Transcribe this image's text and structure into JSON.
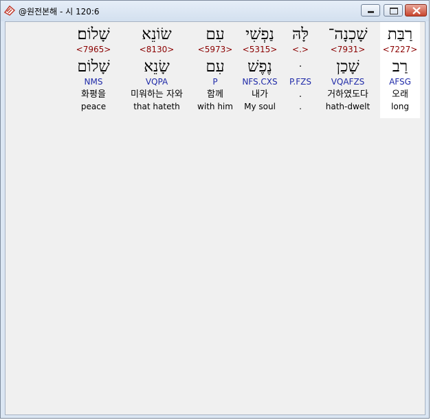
{
  "window": {
    "title": "@원전본해 - 시 120:6",
    "icon": "bible-app-icon"
  },
  "words": [
    {
      "hebrew": "רַבַּת",
      "strong": "<7227>",
      "lemma": "רַב",
      "morph": "AFSG",
      "korean": "오래",
      "english": "long",
      "highlight": true
    },
    {
      "hebrew": "שָׁכְנָה־",
      "strong": "<7931>",
      "lemma": "שָׁכַן",
      "morph": "VQAFZS",
      "korean": "거하였도다",
      "english": "hath-dwelt",
      "highlight": false
    },
    {
      "hebrew": "לָּהּ",
      "strong": "<.>",
      "lemma": "ּ",
      "morph": "P.FZS",
      "korean": ".",
      "english": ".",
      "highlight": false
    },
    {
      "hebrew": "נַפְשִׁי",
      "strong": "<5315>",
      "lemma": "נֶפֶשׁ",
      "morph": "NFS.CXS",
      "korean": "내가",
      "english": "My soul",
      "highlight": false
    },
    {
      "hebrew": "עִם",
      "strong": "<5973>",
      "lemma": "עִם",
      "morph": "P",
      "korean": "함께",
      "english": "with him",
      "highlight": false
    },
    {
      "hebrew": "שׂוֹנֵא",
      "strong": "<8130>",
      "lemma": "שָׂנֵא",
      "morph": "VQPA",
      "korean": "미워하는 자와",
      "english": "that hateth",
      "highlight": false
    },
    {
      "hebrew": "שָׁלוֹם׃",
      "strong": "<7965>",
      "lemma": "שָׁלוֹם",
      "morph": "NMS",
      "korean": "화평을",
      "english": "peace",
      "highlight": false
    }
  ]
}
